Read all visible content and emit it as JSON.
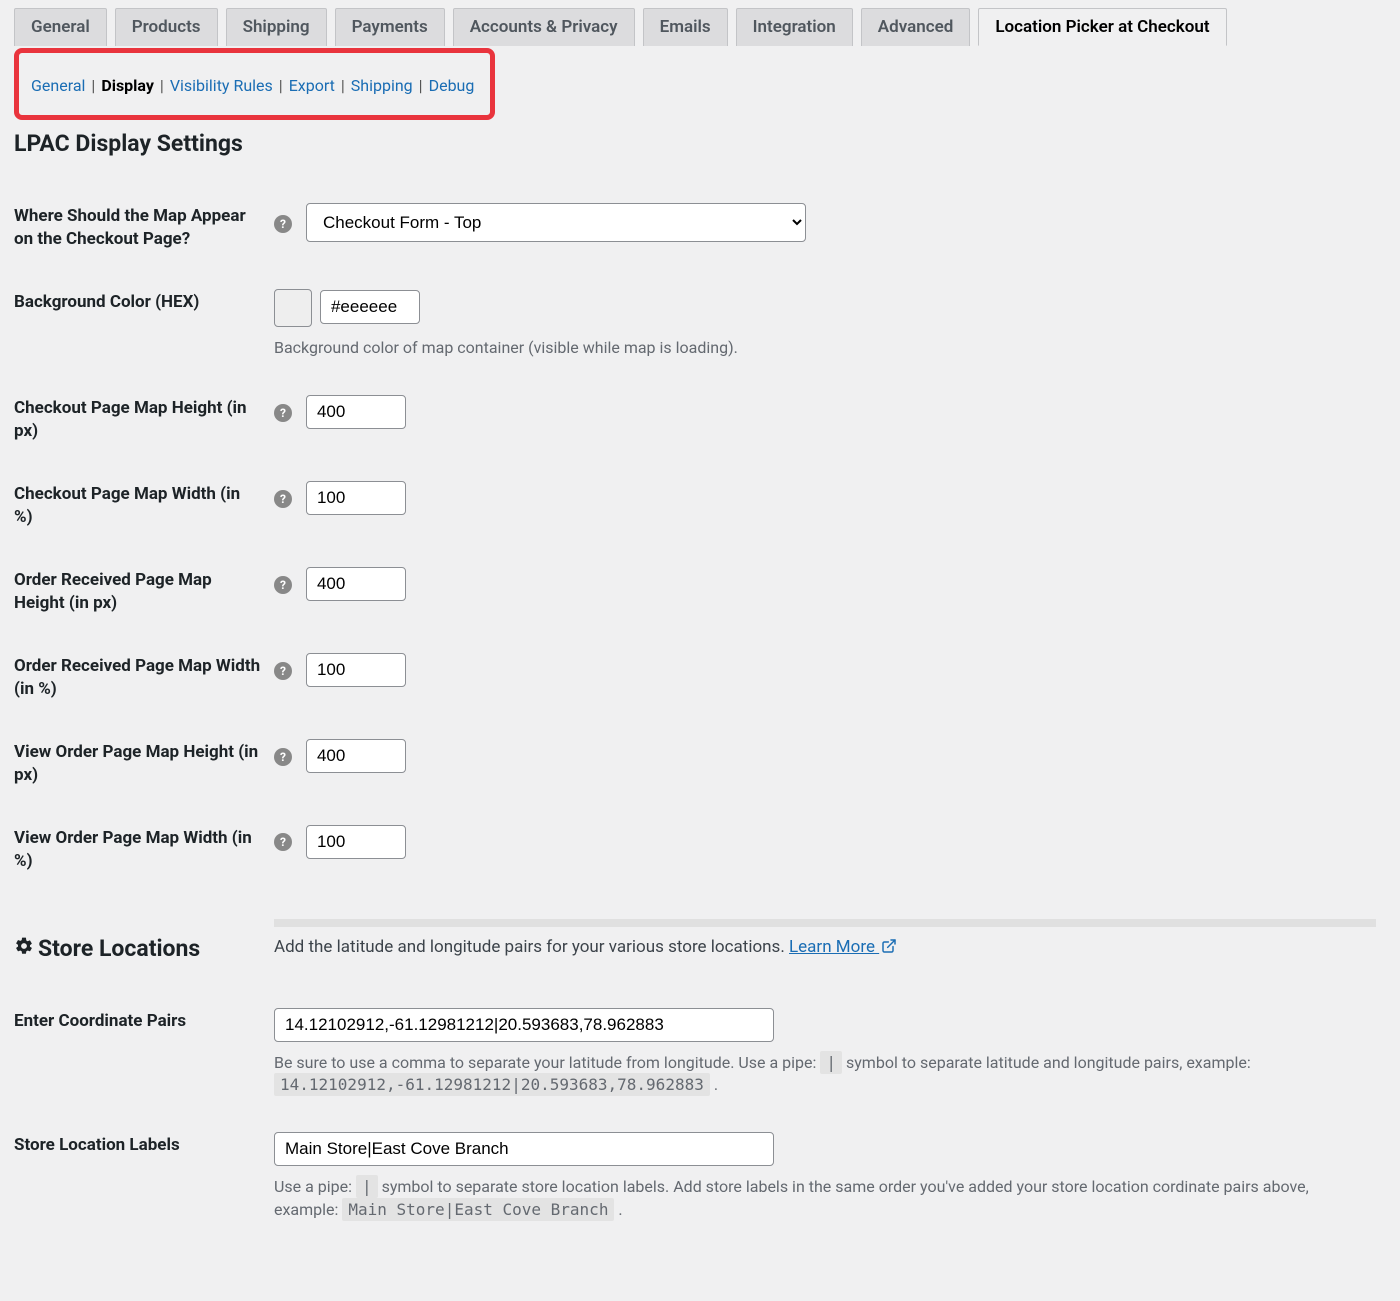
{
  "tabs": {
    "general": "General",
    "products": "Products",
    "shipping": "Shipping",
    "payments": "Payments",
    "accounts": "Accounts & Privacy",
    "emails": "Emails",
    "integration": "Integration",
    "advanced": "Advanced",
    "lpac": "Location Picker at Checkout"
  },
  "subtabs": {
    "general": "General",
    "display": "Display",
    "visibility": "Visibility Rules",
    "export": "Export",
    "shipping": "Shipping",
    "debug": "Debug"
  },
  "heading": "LPAC Display Settings",
  "fields": {
    "where_map": {
      "label": "Where Should the Map Appear on the Checkout Page?",
      "selected": "Checkout Form - Top"
    },
    "bg_color": {
      "label": "Background Color (HEX)",
      "value": "#eeeeee",
      "desc": "Background color of map container (visible while map is loading)."
    },
    "checkout_height": {
      "label": "Checkout Page Map Height (in px)",
      "value": "400"
    },
    "checkout_width": {
      "label": "Checkout Page Map Width (in %)",
      "value": "100"
    },
    "order_received_height": {
      "label": "Order Received Page Map Height (in px)",
      "value": "400"
    },
    "order_received_width": {
      "label": "Order Received Page Map Width (in %)",
      "value": "100"
    },
    "view_order_height": {
      "label": "View Order Page Map Height (in px)",
      "value": "400"
    },
    "view_order_width": {
      "label": "View Order Page Map Width (in %)",
      "value": "100"
    }
  },
  "store_section": {
    "title": "Store Locations",
    "intro": "Add the latitude and longitude pairs for your various store locations. ",
    "learn_more": "Learn More ",
    "coord": {
      "label": "Enter Coordinate Pairs",
      "value": "14.12102912,-61.12981212|20.593683,78.962883",
      "desc1": "Be sure to use a comma to separate your latitude from longitude. Use a pipe: ",
      "pipe": "|",
      "desc2": " symbol to separate latitude and longitude pairs, example: ",
      "example": "14.12102912,-61.12981212|20.593683,78.962883",
      "period": " ."
    },
    "labels": {
      "label": "Store Location Labels",
      "value": "Main Store|East Cove Branch",
      "desc1": "Use a pipe: ",
      "pipe": "|",
      "desc2": " symbol to separate store location labels. Add store labels in the same order you've added your store location cordinate pairs above, example: ",
      "example": "Main Store|East Cove Branch",
      "period": " ."
    }
  }
}
